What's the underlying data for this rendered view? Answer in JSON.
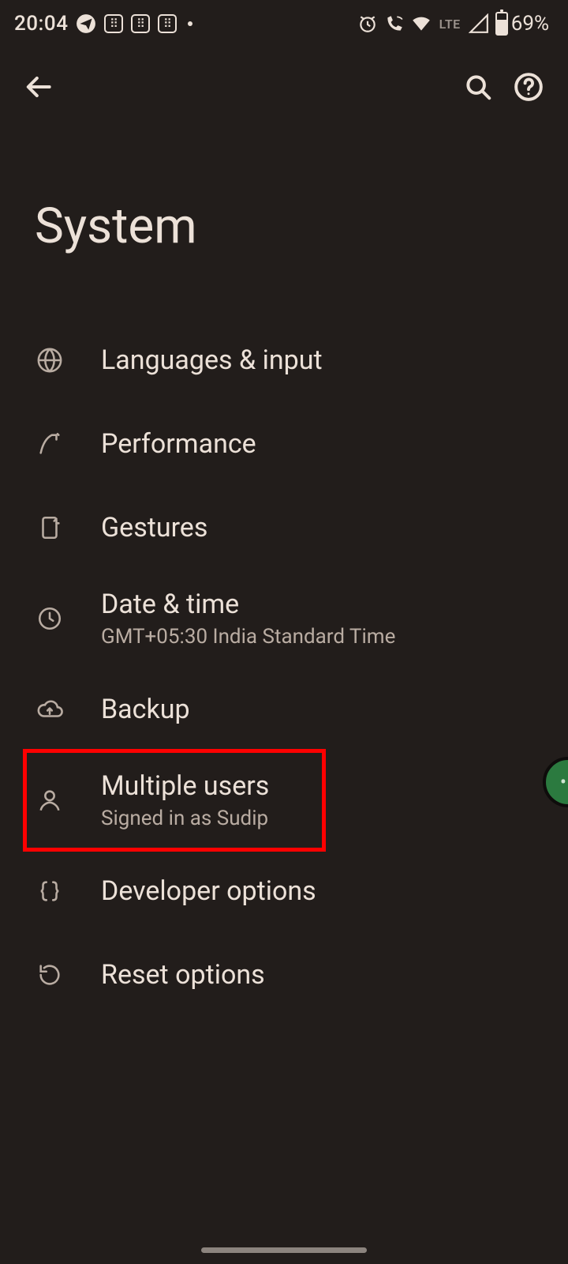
{
  "status": {
    "time": "20:04",
    "network_label": "LTE",
    "battery_pct": "69%"
  },
  "page": {
    "title": "System"
  },
  "items": [
    {
      "title": "Languages & input",
      "sub": ""
    },
    {
      "title": "Performance",
      "sub": ""
    },
    {
      "title": "Gestures",
      "sub": ""
    },
    {
      "title": "Date & time",
      "sub": "GMT+05:30 India Standard Time"
    },
    {
      "title": "Backup",
      "sub": ""
    },
    {
      "title": "Multiple users",
      "sub": "Signed in as Sudip"
    },
    {
      "title": "Developer options",
      "sub": ""
    },
    {
      "title": "Reset options",
      "sub": ""
    }
  ]
}
